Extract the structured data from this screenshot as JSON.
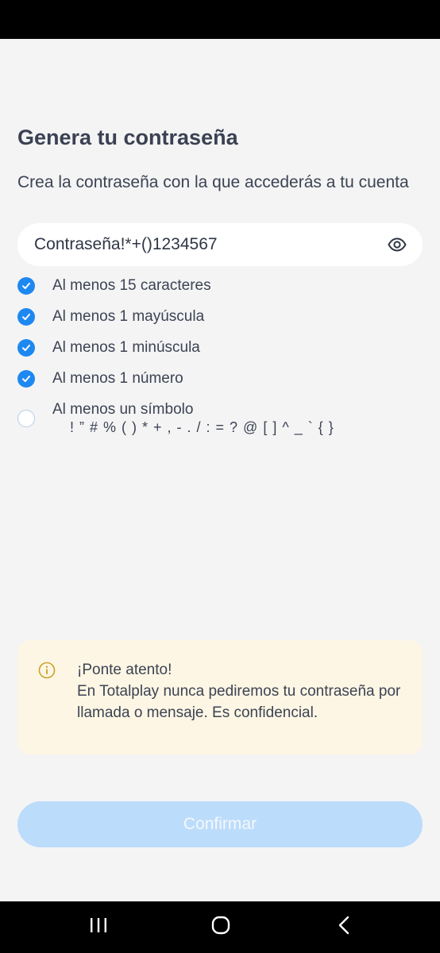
{
  "page": {
    "title": "Genera tu contraseña",
    "subtitle": "Crea la contraseña con la que accederás a tu cuenta"
  },
  "password_field": {
    "value": "Contraseña!*+()1234567",
    "toggle_icon": "eye-icon"
  },
  "requirements": [
    {
      "label": "Al menos 15 caracteres",
      "met": true
    },
    {
      "label": "Al menos 1 mayúscula",
      "met": true
    },
    {
      "label": "Al menos 1 minúscula",
      "met": true
    },
    {
      "label": "Al menos 1 número",
      "met": true
    },
    {
      "label": "Al menos un símbolo",
      "met": false
    }
  ],
  "symbols": "! ” # % ( ) * + , - . / : = ? @ [ ] ^ _ ` { }",
  "notice": {
    "icon": "info-icon",
    "heading": "¡Ponte atento!",
    "body": "En Totalplay nunca pediremos tu contraseña por llamada o mensaje. Es confidencial."
  },
  "confirm_label": "Confirmar",
  "colors": {
    "accent": "#1e88f1",
    "button_disabled": "#bcdcfb",
    "notice_bg": "#fdf6e4"
  },
  "system_nav": [
    "recents-icon",
    "home-icon",
    "back-icon"
  ]
}
